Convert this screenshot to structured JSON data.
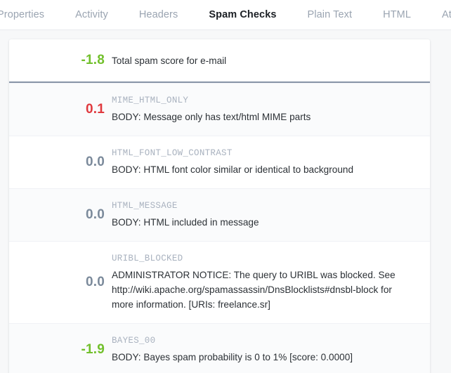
{
  "tabs": [
    {
      "label": "Properties",
      "active": false
    },
    {
      "label": "Activity",
      "active": false
    },
    {
      "label": "Headers",
      "active": false
    },
    {
      "label": "Spam Checks",
      "active": true
    },
    {
      "label": "Plain Text",
      "active": false
    },
    {
      "label": "HTML",
      "active": false
    },
    {
      "label": "Attachments",
      "active": false
    }
  ],
  "colors": {
    "positive_score": "#e0393e",
    "negative_score": "#72c02c",
    "zero_score": "#7b8a9b",
    "rule_name": "#a9b2bf",
    "divider": "#8794a7"
  },
  "total": {
    "score": "-1.8",
    "description": "Total spam score for e-mail"
  },
  "checks": [
    {
      "score": "0.1",
      "rule": "MIME_HTML_ONLY",
      "description": "BODY: Message only has text/html MIME parts"
    },
    {
      "score": "0.0",
      "rule": "HTML_FONT_LOW_CONTRAST",
      "description": "BODY: HTML font color similar or identical to background"
    },
    {
      "score": "0.0",
      "rule": "HTML_MESSAGE",
      "description": "BODY: HTML included in message"
    },
    {
      "score": "0.0",
      "rule": "URIBL_BLOCKED",
      "description": "ADMINISTRATOR NOTICE: The query to URIBL was blocked. See http://wiki.apache.org/spamassassin/DnsBlocklists#dnsbl-block for more information. [URIs: freelance.sr]"
    },
    {
      "score": "-1.9",
      "rule": "BAYES_00",
      "description": "BODY: Bayes spam probability is 0 to 1% [score: 0.0000]"
    }
  ]
}
